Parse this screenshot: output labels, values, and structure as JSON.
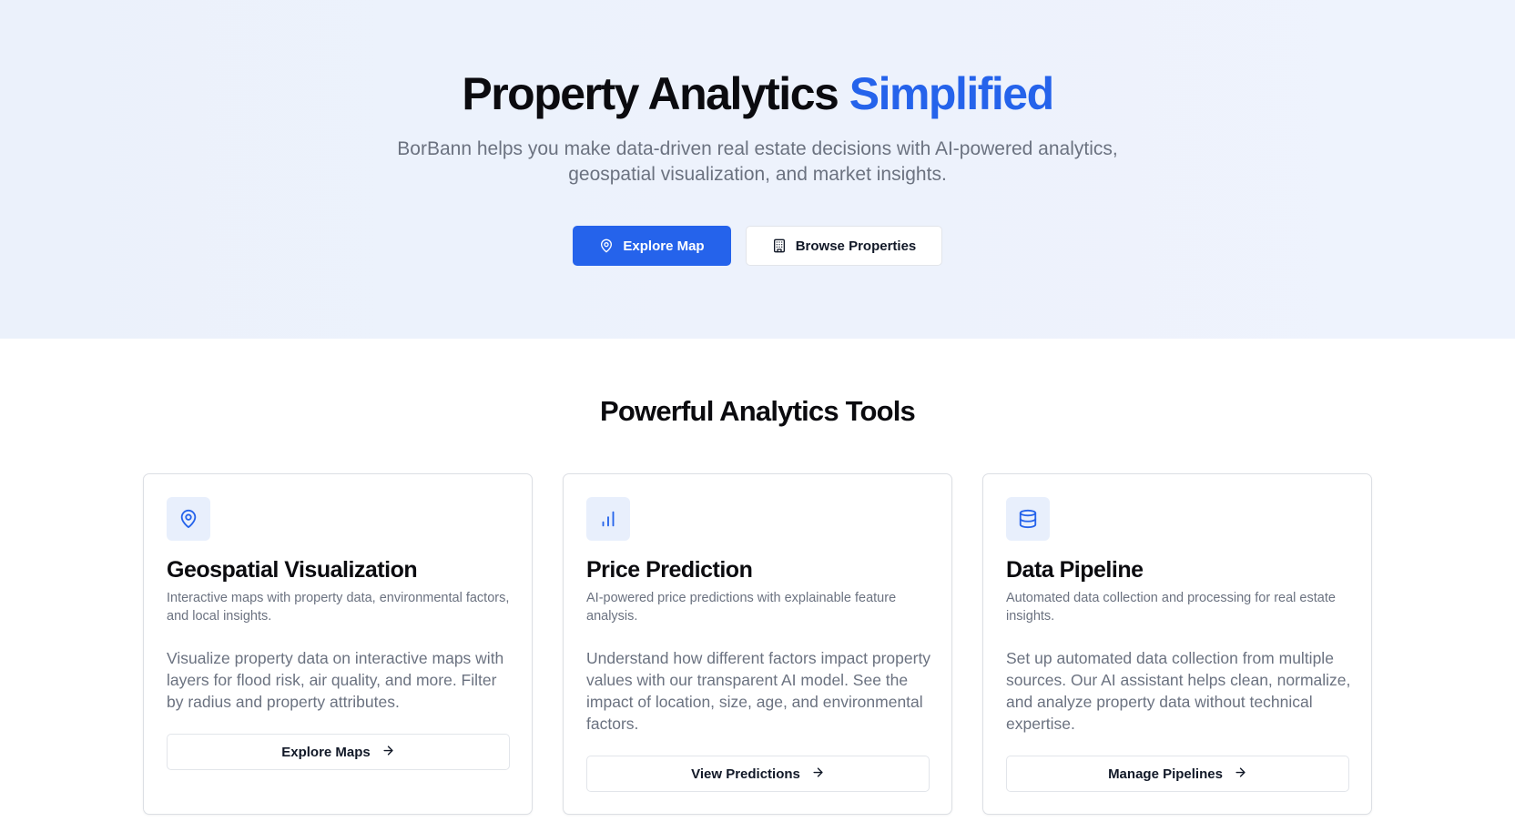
{
  "colors": {
    "accent": "#2563eb",
    "hero_bg": "#edf2fc",
    "muted_text": "#6b7280",
    "icon_bg": "#e8effc"
  },
  "hero": {
    "title_main": "Property Analytics",
    "title_accent": "Simplified",
    "subtitle": "BorBann helps you make data-driven real estate decisions with AI-powered analytics, geospatial visualization, and market insights.",
    "primary_button": {
      "label": "Explore Map",
      "icon": "map-pin-icon"
    },
    "secondary_button": {
      "label": "Browse Properties",
      "icon": "building-icon"
    }
  },
  "features": {
    "title": "Powerful Analytics Tools",
    "cards": [
      {
        "icon": "map-pin-icon",
        "title": "Geospatial Visualization",
        "description": "Interactive maps with property data, environmental factors, and local insights.",
        "body": "Visualize property data on interactive maps with layers for flood risk, air quality, and more. Filter by radius and property attributes.",
        "button": "Explore Maps"
      },
      {
        "icon": "bar-chart-icon",
        "title": "Price Prediction",
        "description": "AI-powered price predictions with explainable feature analysis.",
        "body": "Understand how different factors impact property values with our transparent AI model. See the impact of location, size, age, and environmental factors.",
        "button": "View Predictions"
      },
      {
        "icon": "database-icon",
        "title": "Data Pipeline",
        "description": "Automated data collection and processing for real estate insights.",
        "body": "Set up automated data collection from multiple sources. Our AI assistant helps clean, normalize, and analyze property data without technical expertise.",
        "button": "Manage Pipelines"
      }
    ]
  }
}
